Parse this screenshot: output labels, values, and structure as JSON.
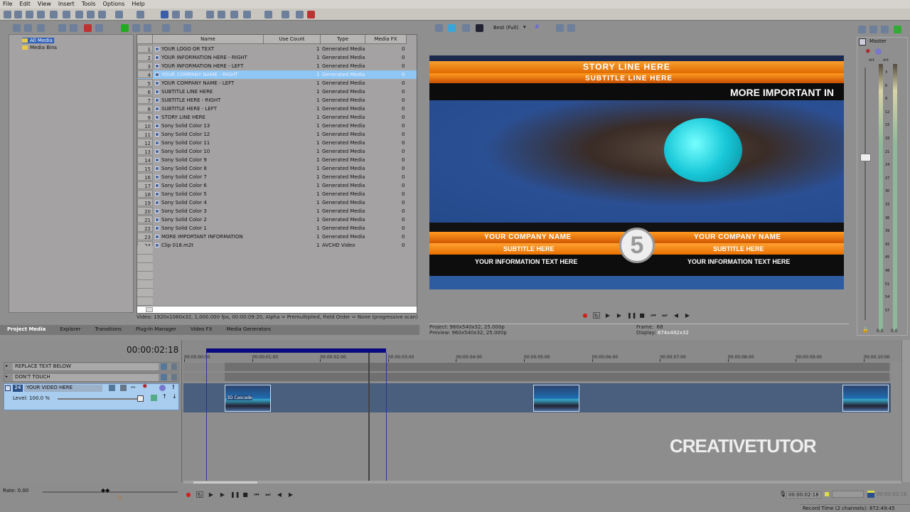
{
  "menu": [
    "File",
    "Edit",
    "View",
    "Insert",
    "Tools",
    "Options",
    "Help"
  ],
  "tree": {
    "items": [
      "All Media",
      "Media Bins"
    ]
  },
  "media_table": {
    "columns": [
      "Name",
      "Use Count",
      "Type",
      "Media FX"
    ],
    "rows": [
      {
        "n": "1",
        "name": "YOUR LOGO OR TEXT",
        "use": "1",
        "type": "Generated Media",
        "fx": "0"
      },
      {
        "n": "2",
        "name": "YOUR INFORMATION HERE - RIGHT",
        "use": "1",
        "type": "Generated Media",
        "fx": "0"
      },
      {
        "n": "3",
        "name": "YOUR INFORMATION HERE - LEFT",
        "use": "1",
        "type": "Generated Media",
        "fx": "0"
      },
      {
        "n": "4",
        "name": "YOUR COMPANY NAME - RIGHT",
        "use": "1",
        "type": "Generated Media",
        "fx": "0",
        "selected": true
      },
      {
        "n": "5",
        "name": "YOUR COMPANY NAME - LEFT",
        "use": "1",
        "type": "Generated Media",
        "fx": "0"
      },
      {
        "n": "6",
        "name": "SUBTITLE LINE HERE",
        "use": "1",
        "type": "Generated Media",
        "fx": "0"
      },
      {
        "n": "7",
        "name": "SUBTITLE HERE - RIGHT",
        "use": "1",
        "type": "Generated Media",
        "fx": "0"
      },
      {
        "n": "8",
        "name": "SUBTITLE HERE - LEFT",
        "use": "1",
        "type": "Generated Media",
        "fx": "0"
      },
      {
        "n": "9",
        "name": "STORY LINE HERE",
        "use": "1",
        "type": "Generated Media",
        "fx": "0"
      },
      {
        "n": "10",
        "name": "Sony Solid Color 13",
        "use": "1",
        "type": "Generated Media",
        "fx": "0"
      },
      {
        "n": "11",
        "name": "Sony Solid Color 12",
        "use": "1",
        "type": "Generated Media",
        "fx": "0"
      },
      {
        "n": "12",
        "name": "Sony Solid Color 11",
        "use": "1",
        "type": "Generated Media",
        "fx": "0"
      },
      {
        "n": "13",
        "name": "Sony Solid Color 10",
        "use": "1",
        "type": "Generated Media",
        "fx": "0"
      },
      {
        "n": "14",
        "name": "Sony Solid Color 9",
        "use": "1",
        "type": "Generated Media",
        "fx": "0"
      },
      {
        "n": "15",
        "name": "Sony Solid Color 8",
        "use": "1",
        "type": "Generated Media",
        "fx": "0"
      },
      {
        "n": "16",
        "name": "Sony Solid Color 7",
        "use": "1",
        "type": "Generated Media",
        "fx": "0"
      },
      {
        "n": "17",
        "name": "Sony Solid Color 6",
        "use": "1",
        "type": "Generated Media",
        "fx": "0"
      },
      {
        "n": "18",
        "name": "Sony Solid Color 5",
        "use": "1",
        "type": "Generated Media",
        "fx": "0"
      },
      {
        "n": "19",
        "name": "Sony Solid Color 4",
        "use": "1",
        "type": "Generated Media",
        "fx": "0"
      },
      {
        "n": "20",
        "name": "Sony Solid Color 3",
        "use": "1",
        "type": "Generated Media",
        "fx": "0"
      },
      {
        "n": "21",
        "name": "Sony Solid Color 2",
        "use": "1",
        "type": "Generated Media",
        "fx": "0"
      },
      {
        "n": "22",
        "name": "Sony Solid Color 1",
        "use": "1",
        "type": "Generated Media",
        "fx": "0"
      },
      {
        "n": "23",
        "name": "MORE IMPORTANT INFORMATION",
        "use": "1",
        "type": "Generated Media",
        "fx": "0"
      },
      {
        "n": "24",
        "name": "Clip 018.m2t",
        "use": "1",
        "type": "AVCHD Video",
        "fx": "0"
      }
    ]
  },
  "media_info": "Video: 1920x1080x32, 1,000.000 fps, 00:00:09:20, Alpha = Premultiplied, Field Order = None (progressive scan)",
  "tabs": [
    "Project Media",
    "Explorer",
    "Transitions",
    "Plug-In Manager",
    "Video FX",
    "Media Generators"
  ],
  "preview": {
    "quality": "Best (Full)",
    "overlay": {
      "story": "STORY LINE HERE",
      "subtitle_line": "SUBTITLE LINE HERE",
      "important": "MORE IMPORTANT IN",
      "company_left": "YOUR COMPANY NAME",
      "company_right": "YOUR COMPANY NAME",
      "subtitle_left": "SUBTITLE HERE",
      "subtitle_right": "SUBTITLE HERE",
      "info_left": "YOUR INFORMATION TEXT HERE",
      "info_right": "YOUR INFORMATION TEXT HERE",
      "logo_number": "5"
    },
    "project_label": "Project:",
    "project": "960x540x32, 25.000p",
    "preview_label": "Preview:",
    "preview": "960x540x32, 25.000p",
    "frame_label": "Frame:",
    "frame": "68",
    "display_label": "Display:",
    "display": "874x492x32"
  },
  "mixer": {
    "title": "Master",
    "top": "-Inf.",
    "scale": [
      "3",
      "6",
      "9",
      "12",
      "15",
      "18",
      "21",
      "24",
      "27",
      "30",
      "33",
      "36",
      "39",
      "42",
      "45",
      "48",
      "51",
      "54",
      "57"
    ],
    "left_value": "0.0",
    "right_value": "0.0"
  },
  "timeline": {
    "timecode": "00:00:02:18",
    "ruler": [
      "00:00:00:00",
      "00:00:01:00",
      "00:00:02:00",
      "00:00:03:00",
      "00:00:04:00",
      "00:00:05:00",
      "00:00:06:00",
      "00:00:07:00",
      "00:00:08:00",
      "00:00:09:00",
      "00:00:10:00"
    ],
    "tracks": [
      {
        "name": "REPLACE TEXT BELOW"
      },
      {
        "name": "DON'T TOUCH"
      },
      {
        "name": "YOUR VIDEO HERE",
        "number": "24",
        "level": "Level: 100.0 %"
      }
    ],
    "clip_label": "3D Cascade",
    "rate": "Rate: 0.00",
    "cursor_time": "00:00:02:18",
    "selection_time": "00:00:02:16",
    "record_time": "Record Time (2 channels): 872:49:45"
  },
  "watermark": "CREATIVETUTOR"
}
